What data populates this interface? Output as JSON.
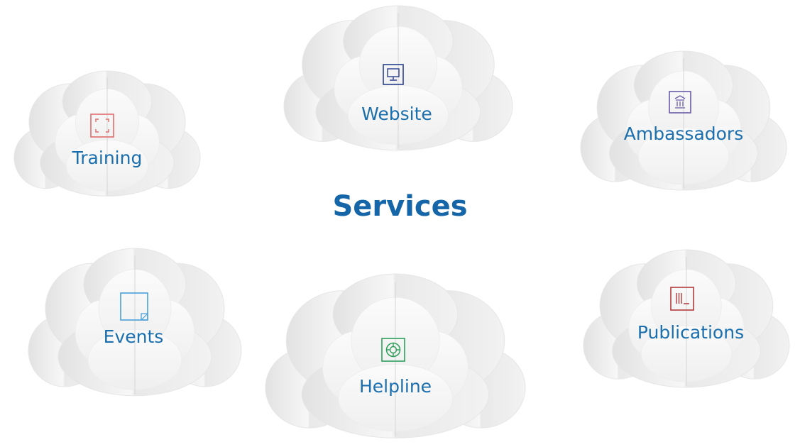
{
  "title": "Services",
  "colors": {
    "label": "#1b6fae",
    "title": "#1466a8",
    "cloud_base": "#f4f4f4",
    "cloud_shade": "#dcdcdc"
  },
  "services": [
    {
      "label": "Training",
      "icon": "focus-frame-icon",
      "icon_color": "#e06c6c"
    },
    {
      "label": "Website",
      "icon": "monitor-icon",
      "icon_color": "#2a3f8f"
    },
    {
      "label": "Ambassadors",
      "icon": "institution-building-icon",
      "icon_color": "#6a5aa8"
    },
    {
      "label": "Events",
      "icon": "resize-square-icon",
      "icon_color": "#4a9fd8"
    },
    {
      "label": "Helpline",
      "icon": "lifebuoy-icon",
      "icon_color": "#2e9e5a"
    },
    {
      "label": "Publications",
      "icon": "library-books-icon",
      "icon_color": "#b33a3a"
    }
  ]
}
